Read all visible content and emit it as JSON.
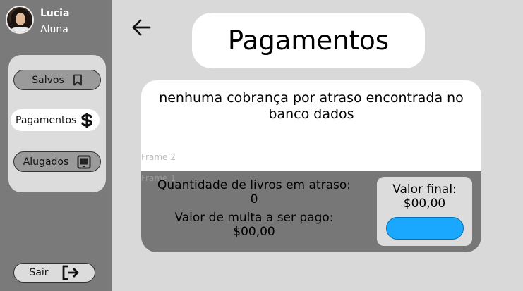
{
  "user": {
    "name": "Lucia",
    "role": "Aluna"
  },
  "sidebar": {
    "items": [
      {
        "label": "Salvos",
        "icon": "bookmark-icon"
      },
      {
        "label": "Pagamentos",
        "icon": "dollar-icon"
      },
      {
        "label": "Alugados",
        "icon": "tablet-icon"
      }
    ],
    "exit": {
      "label": "Sair",
      "icon": "exit-icon"
    }
  },
  "header": {
    "title": "Pagamentos",
    "back_icon": "arrow-left-icon"
  },
  "card": {
    "message": "nenhuma cobrança por atraso encontrada no banco dados",
    "frame2_label": "Frame 2",
    "frame1_label": "Frame 1",
    "overdue_label": "Quantidade de livros em atraso:",
    "overdue_value": "0",
    "fine_label": "Valor de multa a ser pago:",
    "fine_value": "$00,00",
    "final_label": "Valor final:",
    "final_value": "$00,00"
  },
  "colors": {
    "sidebar": "#7a7a7a",
    "background": "#d9d9d9",
    "pay_button": "#1aa8ff"
  }
}
